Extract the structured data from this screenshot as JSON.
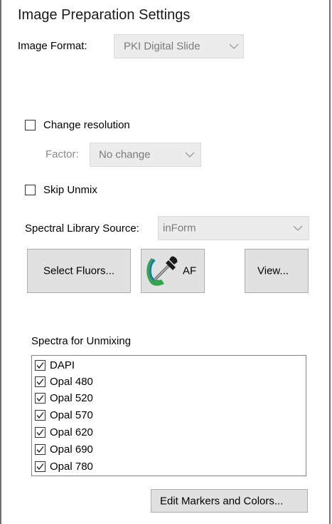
{
  "panel": {
    "title": "Image Preparation Settings"
  },
  "image_format": {
    "label": "Image Format:",
    "value": "PKI Digital Slide"
  },
  "change_resolution": {
    "label": "Change resolution",
    "checked": false,
    "factor_label": "Factor:",
    "factor_value": "No change"
  },
  "skip_unmix": {
    "label": "Skip Unmix",
    "checked": false
  },
  "spectral_library": {
    "label": "Spectral Library Source:",
    "value": "inForm"
  },
  "buttons": {
    "select_fluors": "Select Fluors...",
    "af": "AF",
    "view": "View...",
    "edit_markers": "Edit Markers and Colors..."
  },
  "spectra": {
    "label": "Spectra for Unmixing",
    "items": [
      {
        "label": "DAPI",
        "checked": true
      },
      {
        "label": "Opal 480",
        "checked": true
      },
      {
        "label": "Opal 520",
        "checked": true
      },
      {
        "label": "Opal 570",
        "checked": true
      },
      {
        "label": "Opal 620",
        "checked": true
      },
      {
        "label": "Opal 690",
        "checked": true
      },
      {
        "label": "Opal 780",
        "checked": true
      }
    ]
  },
  "icons": {
    "af_icon": "eyedropper-icon",
    "dropdown_icon": "chevron-down-icon",
    "check_icon": "checkmark-icon"
  },
  "colors": {
    "button_face": "#e1e1e1",
    "disabled_combo": "#ececec",
    "af_icon_green": "#2fa84a",
    "af_icon_blue": "#1b6fd1"
  }
}
